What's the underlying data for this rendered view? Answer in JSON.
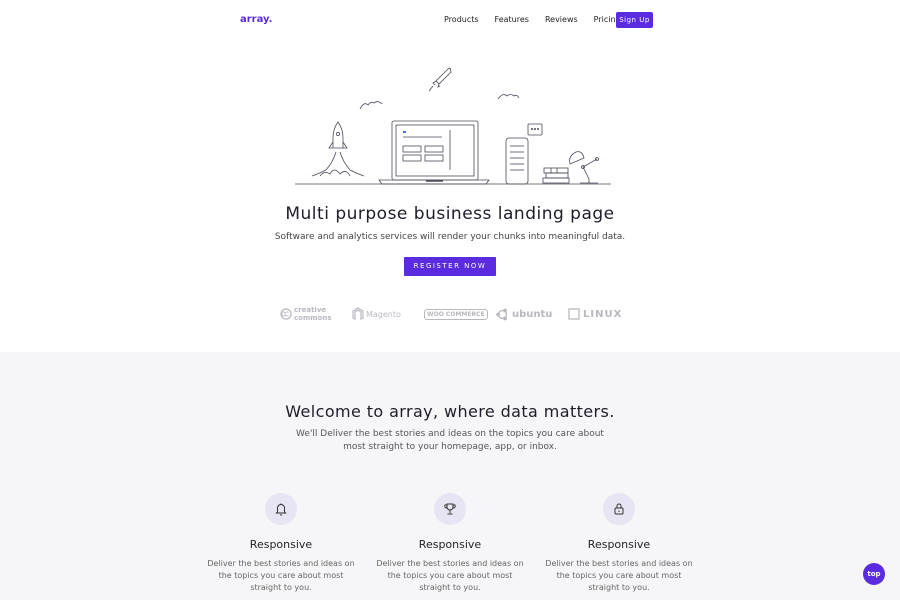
{
  "nav": {
    "logo": "array.",
    "links": [
      "Products",
      "Features",
      "Reviews",
      "Pricing"
    ],
    "signup_label": "Sign Up"
  },
  "hero": {
    "title": "Multi purpose business landing page",
    "subtitle": "Software and analytics services will render your chunks into meaningful data.",
    "cta_label": "REGISTER NOW"
  },
  "brands": [
    {
      "name": "creative commons",
      "icon": "creative-commons-logo"
    },
    {
      "name": "Magento",
      "icon": "magento-logo"
    },
    {
      "name": "WOO COMMERCE",
      "icon": "woocommerce-logo"
    },
    {
      "name": "ubuntu",
      "icon": "ubuntu-logo"
    },
    {
      "name": "LINUX",
      "icon": "linux-logo"
    }
  ],
  "welcome": {
    "title": "Welcome to array, where data matters.",
    "subtitle": "We'll Deliver the best stories and ideas on the topics you care about most straight to your homepage, app, or inbox."
  },
  "features": [
    {
      "icon": "bell-icon",
      "title": "Responsive",
      "desc": "Deliver the best stories and ideas on the topics you care about most straight to you."
    },
    {
      "icon": "trophy-icon",
      "title": "Responsive",
      "desc": "Deliver the best stories and ideas on the topics you care about most straight to you."
    },
    {
      "icon": "lock-icon",
      "title": "Responsive",
      "desc": "Deliver the best stories and ideas on the topics you care about most straight to you."
    }
  ],
  "top_button": "top",
  "colors": {
    "accent": "#5b2be0",
    "section_bg": "#f6f6f8",
    "icon_bg": "#e7e4f3"
  }
}
